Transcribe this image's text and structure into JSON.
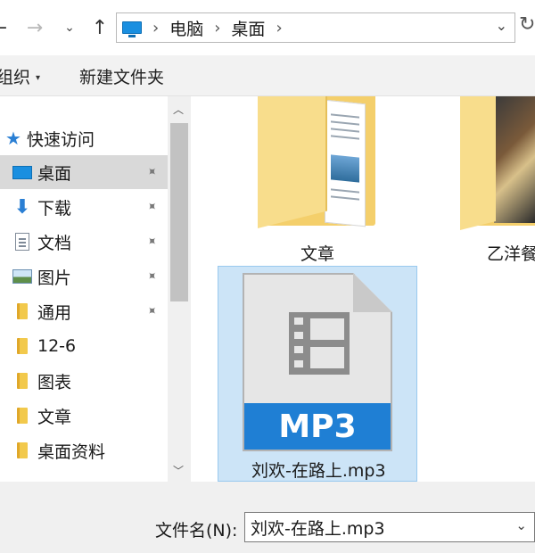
{
  "nav": {
    "back_glyph": "←",
    "forward_glyph": "→",
    "recent_glyph": "⌄",
    "up_glyph": "↑"
  },
  "address": {
    "crumbs": [
      "电脑",
      "桌面"
    ],
    "separator": "›",
    "dropdown_glyph": "⌄",
    "refresh_glyph": "↻"
  },
  "toolbar": {
    "organize_label": "组织",
    "organize_arrow": "▾",
    "new_folder_label": "新建文件夹"
  },
  "sidebar": {
    "quick_access_label": "快速访问",
    "items": [
      {
        "label": "桌面",
        "icon": "desktop-icon",
        "pinned": true,
        "selected": true
      },
      {
        "label": "下载",
        "icon": "download-icon",
        "pinned": true
      },
      {
        "label": "文档",
        "icon": "document-icon",
        "pinned": true
      },
      {
        "label": "图片",
        "icon": "pictures-icon",
        "pinned": true
      },
      {
        "label": "通用",
        "icon": "folder-icon",
        "pinned": true
      },
      {
        "label": "12-6",
        "icon": "folder-icon",
        "pinned": false
      },
      {
        "label": "图表",
        "icon": "folder-icon",
        "pinned": false
      },
      {
        "label": "文章",
        "icon": "folder-icon",
        "pinned": false
      },
      {
        "label": "桌面资料",
        "icon": "folder-icon",
        "pinned": false
      }
    ],
    "pin_glyph": "📌"
  },
  "files": [
    {
      "name": "文章",
      "type": "folder"
    },
    {
      "name": "乙洋餐",
      "type": "folder"
    },
    {
      "name": "刘欢-在路上.mp3",
      "type": "mp3",
      "badge": "MP3",
      "selected": true
    }
  ],
  "bottom": {
    "filename_label": "文件名(N):",
    "filename_value": "刘欢-在路上.mp3"
  },
  "colors": {
    "accent": "#1f7fd4",
    "selection": "#cce4f7",
    "folder": "#f4cf6b"
  }
}
